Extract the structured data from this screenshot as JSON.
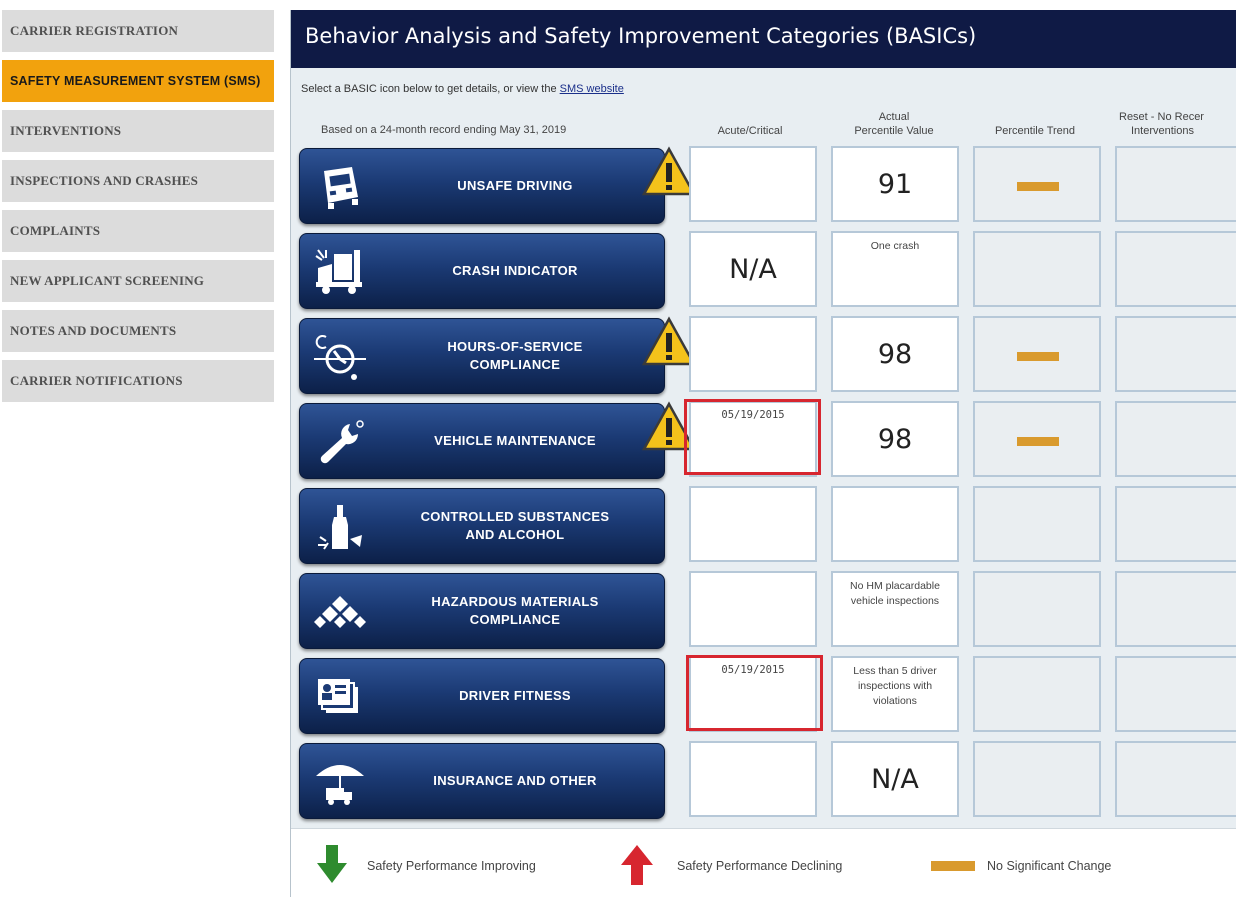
{
  "sidebar": {
    "items": [
      {
        "label": "CARRIER REGISTRATION",
        "active": false
      },
      {
        "label": "SAFETY MEASUREMENT SYSTEM (SMS)",
        "active": true
      },
      {
        "label": "INTERVENTIONS",
        "active": false
      },
      {
        "label": "INSPECTIONS AND CRASHES",
        "active": false
      },
      {
        "label": "COMPLAINTS",
        "active": false
      },
      {
        "label": "NEW APPLICANT SCREENING",
        "active": false
      },
      {
        "label": "NOTES AND DOCUMENTS",
        "active": false
      },
      {
        "label": "CARRIER NOTIFICATIONS",
        "active": false
      }
    ]
  },
  "panel": {
    "title": "Behavior Analysis and Safety Improvement Categories (BASICs)",
    "intro_prefix": "Select a BASIC icon below to get details, or view the",
    "intro_link": "SMS website",
    "record_note": "Based on a 24-month record ending May 31, 2019",
    "columns": {
      "acute": "Acute/Critical",
      "percentile_l1": "Actual",
      "percentile_l2": "Percentile Value",
      "trend": "Percentile Trend",
      "reset_l1": "Reset - No Recer",
      "reset_l2": "Interventions"
    }
  },
  "basics": [
    {
      "label": "UNSAFE DRIVING",
      "icon": "truck-front-icon",
      "warning": true,
      "acute": "",
      "acute_flag": false,
      "percentile": "91",
      "percentile_note": "",
      "trend": "no-change"
    },
    {
      "label": "CRASH INDICATOR",
      "icon": "crashed-truck-icon",
      "warning": false,
      "acute": "N/A",
      "acute_flag": false,
      "percentile": "",
      "percentile_note": "One crash",
      "trend": ""
    },
    {
      "label": "HOURS-OF-SERVICE\nCOMPLIANCE",
      "icon": "clock-icon",
      "warning": true,
      "acute": "",
      "acute_flag": false,
      "percentile": "98",
      "percentile_note": "",
      "trend": "no-change"
    },
    {
      "label": "VEHICLE MAINTENANCE",
      "icon": "wrench-icon",
      "warning": true,
      "acute": "05/19/2015",
      "acute_flag": true,
      "percentile": "98",
      "percentile_note": "",
      "trend": "no-change"
    },
    {
      "label": "CONTROLLED SUBSTANCES\nAND ALCOHOL",
      "icon": "bottle-icon",
      "warning": false,
      "acute": "",
      "acute_flag": false,
      "percentile": "",
      "percentile_note": "",
      "trend": ""
    },
    {
      "label": "HAZARDOUS MATERIALS\nCOMPLIANCE",
      "icon": "hazmat-diamond-icon",
      "warning": false,
      "acute": "",
      "acute_flag": false,
      "percentile": "",
      "percentile_note": "No HM placardable vehicle inspections",
      "trend": ""
    },
    {
      "label": "DRIVER FITNESS",
      "icon": "license-card-icon",
      "warning": false,
      "acute": "05/19/2015",
      "acute_flag": true,
      "percentile": "",
      "percentile_note": "Less than 5 driver inspections with violations",
      "trend": ""
    },
    {
      "label": "INSURANCE AND OTHER",
      "icon": "umbrella-truck-icon",
      "warning": false,
      "acute": "",
      "acute_flag": false,
      "percentile": "N/A",
      "percentile_note": "",
      "trend": ""
    }
  ],
  "legend": {
    "improving": "Safety Performance Improving",
    "declining": "Safety Performance Declining",
    "no_change": "No Significant Change"
  },
  "colors": {
    "header_bg": "#0f1a45",
    "active_tab": "#f2a20d",
    "flag_red": "#d7262f",
    "trend_bar": "#d99a2e",
    "improving_green": "#2e8b2e",
    "declining_red": "#d7262f",
    "warning_yellow": "#f4c21b"
  }
}
